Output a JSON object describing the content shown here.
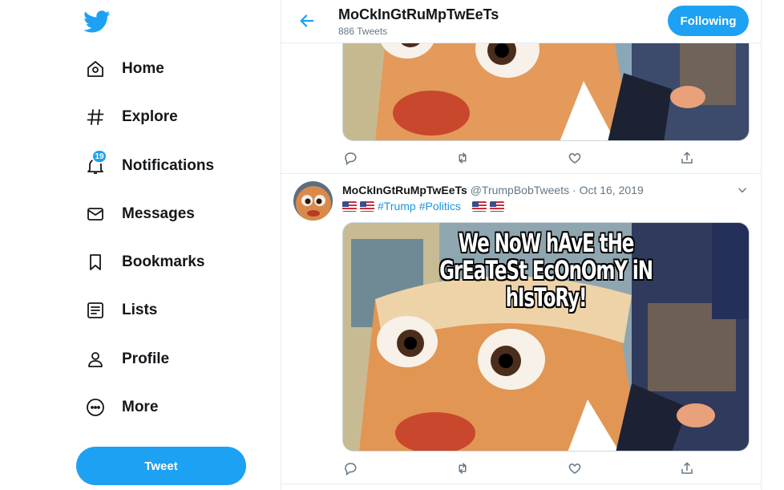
{
  "sidebar": {
    "logo_icon": "twitter-bird-icon",
    "items": [
      {
        "label": "Home",
        "icon": "home-icon"
      },
      {
        "label": "Explore",
        "icon": "hashtag-icon"
      },
      {
        "label": "Notifications",
        "icon": "bell-icon",
        "badge": "19"
      },
      {
        "label": "Messages",
        "icon": "envelope-icon"
      },
      {
        "label": "Bookmarks",
        "icon": "bookmark-icon"
      },
      {
        "label": "Lists",
        "icon": "list-icon"
      },
      {
        "label": "Profile",
        "icon": "person-icon"
      },
      {
        "label": "More",
        "icon": "more-circle-icon"
      }
    ],
    "tweet_button": "Tweet"
  },
  "header": {
    "title": "MoCkInGtRuMpTwEeTs",
    "subtitle": "886 Tweets",
    "follow_button": "Following"
  },
  "tweet": {
    "display_name": "MoCkInGtRuMpTwEeTs",
    "handle": "@TrumpBobTweets",
    "separator": "·",
    "date": "Oct 16, 2019",
    "hashtags": [
      "#Trump",
      "#Politics"
    ],
    "meme_caption_line1": "We NoW hAvE tHe",
    "meme_caption_line2": "GrEaTeSt EcOnOmY iN hIsToRy!"
  },
  "colors": {
    "accent": "#1da1f2",
    "text": "#14171a",
    "muted": "#657786",
    "border": "#e6ecf0",
    "link": "#1b95e0"
  }
}
